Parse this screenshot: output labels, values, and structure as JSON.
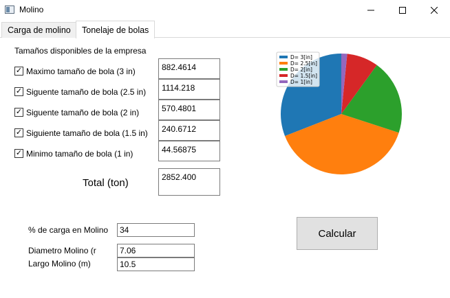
{
  "window": {
    "title": "Molino",
    "icon": "app-window-icon"
  },
  "tabs": [
    {
      "label": "Carga de molino",
      "active": false
    },
    {
      "label": "Tonelaje de bolas",
      "active": true
    }
  ],
  "sizes_heading": "Tamaños disponibles de la empresa",
  "ball_rows": [
    {
      "label": "Maximo tamaño de bola (3 in)",
      "checked": true,
      "value": "882.4614"
    },
    {
      "label": "Siguente tamaño de bola (2.5 in)",
      "checked": true,
      "value": "1114.218"
    },
    {
      "label": "Siguente tamaño de bola (2 in)",
      "checked": true,
      "value": "570.4801"
    },
    {
      "label": "Siguiente tamaño de bola (1.5 in)",
      "checked": true,
      "value": "240.6712"
    },
    {
      "label": "Minimo tamaño de bola (1 in)",
      "checked": true,
      "value": "44.56875"
    }
  ],
  "total": {
    "label": "Total (ton)",
    "value": "2852.400"
  },
  "mill": {
    "load_label": "% de carga en Molino",
    "load_value": "34",
    "diameter_label": "Diametro Molino (r",
    "diameter_value": "7.06",
    "length_label": "Largo Molino (m)",
    "length_value": "10.5"
  },
  "calculate_label": "Calcular",
  "chart_data": {
    "type": "pie",
    "legend_position": "top-left",
    "series": [
      {
        "name": "D= 3[in]",
        "value": 882.4614,
        "color": "#1f77b4"
      },
      {
        "name": "D= 2.5[in]",
        "value": 1114.218,
        "color": "#ff7f0e"
      },
      {
        "name": "D= 2[in]",
        "value": 570.4801,
        "color": "#2ca02c"
      },
      {
        "name": "D= 1.5[in]",
        "value": 240.6712,
        "color": "#d62728"
      },
      {
        "name": "D= 1[in]",
        "value": 44.56875,
        "color": "#9467bd"
      }
    ]
  }
}
